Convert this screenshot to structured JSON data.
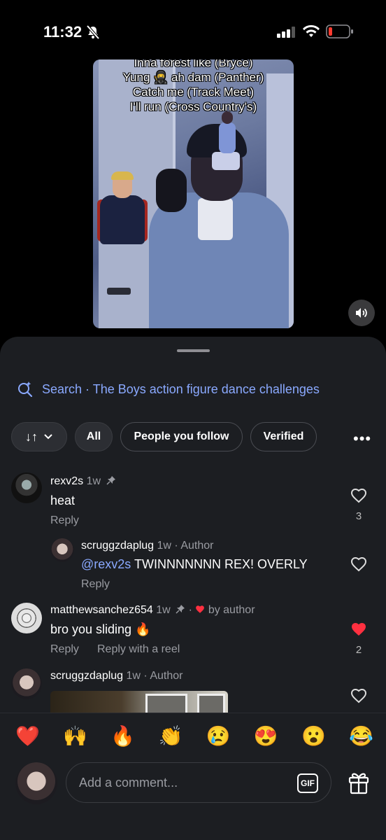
{
  "status_bar": {
    "time": "11:32"
  },
  "video": {
    "lyrics": [
      "Inna forest like (Bryce)",
      "Yung 🥷 ah dam (Panther)",
      "Catch me (Track Meet)",
      "I'll run (Cross Country's)"
    ]
  },
  "search": {
    "label": "Search · The Boys action figure dance challenges"
  },
  "filters": {
    "sort_icon": "↓↑",
    "items": [
      "All",
      "People you follow",
      "Verified"
    ],
    "more_icon": "•••"
  },
  "comments": [
    {
      "username": "rexv2s",
      "time": "1w",
      "text": "heat",
      "reply_label": "Reply",
      "likes": "3",
      "pinned": true
    },
    {
      "username": "scruggzdaplug",
      "time": "1w · Author",
      "mention": "@rexv2s",
      "text": " TWINNNNNNN REX! OVERLY",
      "reply_label": "Reply",
      "likes": ""
    },
    {
      "username": "matthewsanchez654",
      "time": "1w",
      "liked_by": "by author",
      "text": "bro you sliding 🔥",
      "reply_label": "Reply",
      "reply_reel_label": "Reply with a reel",
      "likes": "2",
      "liked": true
    },
    {
      "username": "scruggzdaplug",
      "time": "1w · Author",
      "text": "",
      "likes": ""
    }
  ],
  "reactions": [
    "❤️",
    "🙌",
    "🔥",
    "👏",
    "😢",
    "😍",
    "😮",
    "😂"
  ],
  "composer": {
    "placeholder": "Add a comment...",
    "gif_label": "GIF"
  },
  "colors": {
    "accent": "#8aa9ff",
    "like_red": "#ff3040",
    "sheet_bg": "#1c1e22"
  }
}
